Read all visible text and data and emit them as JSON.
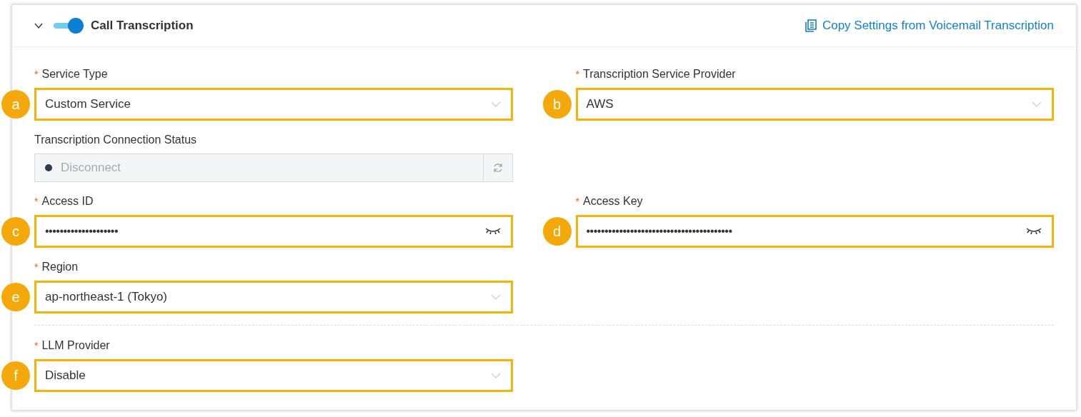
{
  "section": {
    "title": "Call Transcription",
    "expanded": true,
    "enabled": true,
    "copy_link": "Copy Settings from Voicemail Transcription"
  },
  "groups": [
    {
      "rows": [
        [
          {
            "kind": "select",
            "label": "Service Type",
            "mark": "*",
            "value": "Custom Service",
            "callout": "a"
          },
          {
            "kind": "select",
            "label": "Transcription Service Provider",
            "mark": "*",
            "value": "AWS",
            "callout": "b"
          }
        ],
        [
          {
            "kind": "status",
            "label": "Transcription Connection Status",
            "value": "Disconnect",
            "disabled": true
          }
        ],
        [
          {
            "kind": "password",
            "label": "Access ID",
            "mark": "*",
            "value": "••••••••••••••••••••",
            "callout": "c"
          },
          {
            "kind": "password",
            "label": "Access Key",
            "mark": "*",
            "value": "••••••••••••••••••••••••••••••••••••••••",
            "callout": "d"
          }
        ],
        [
          {
            "kind": "select",
            "label": "Region",
            "mark": "*",
            "value": "ap-northeast-1 (Tokyo)",
            "callout": "e"
          }
        ]
      ]
    },
    {
      "rows": [
        [
          {
            "kind": "select",
            "label": "LLM Provider",
            "mark": "*",
            "value": "Disable",
            "callout": "f"
          }
        ]
      ]
    }
  ]
}
